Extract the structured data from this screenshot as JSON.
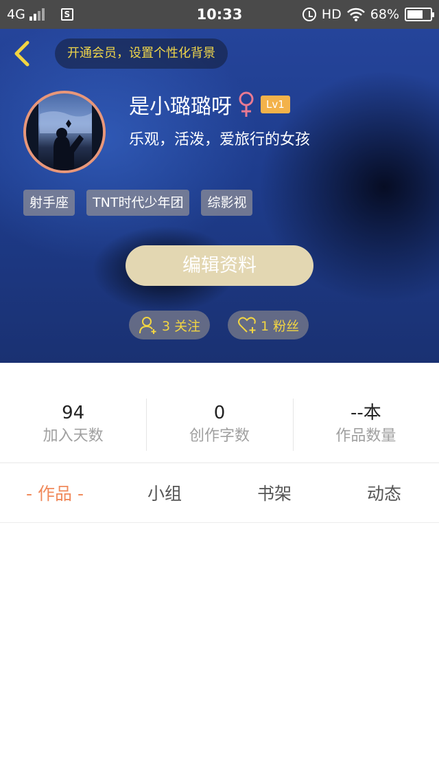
{
  "status_bar": {
    "network": "4G",
    "sim_label": "S",
    "time": "10:33",
    "hd": "HD",
    "battery": "68%",
    "battery_level": 0.68
  },
  "header": {
    "vip_prompt": "开通会员，设置个性化背景",
    "user": {
      "name": "是小璐璐呀",
      "gender_symbol": "♀",
      "level": "Lv1",
      "bio": "乐观，活泼，爱旅行的女孩"
    },
    "tags": [
      "射手座",
      "TNT时代少年团",
      "综影视"
    ],
    "edit_button": "编辑资料",
    "following": "3 关注",
    "followers": "1 粉丝"
  },
  "stats": [
    {
      "value": "94",
      "label": "加入天数"
    },
    {
      "value": "0",
      "label": "创作字数"
    },
    {
      "value": "--本",
      "label": "作品数量"
    }
  ],
  "tabs": [
    "- 作品 -",
    "小组",
    "书架",
    "动态"
  ],
  "colors": {
    "accent_orange": "#f0895a",
    "gold_text": "#f2d542",
    "edit_button_bg": "#e3d7b2",
    "level_badge": "#f3b24a",
    "avatar_ring": "#e8977a"
  }
}
